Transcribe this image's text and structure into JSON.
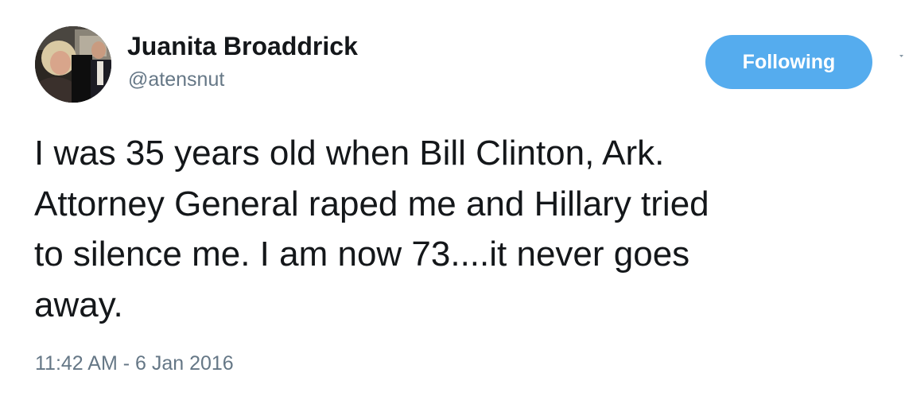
{
  "tweet": {
    "author": {
      "display_name": "Juanita Broaddrick",
      "username": "@atensnut",
      "avatar_icon": "profile-photo-icon"
    },
    "follow_button": {
      "label": "Following",
      "color": "#55acee"
    },
    "menu_icon": "caret-down-icon",
    "text": "I was 35 years old when Bill Clinton, Ark.\nAttorney General raped me and Hillary tried\nto silence me.  I am now 73....it never goes\naway.",
    "timestamp": "11:42 AM - 6 Jan 2016"
  }
}
